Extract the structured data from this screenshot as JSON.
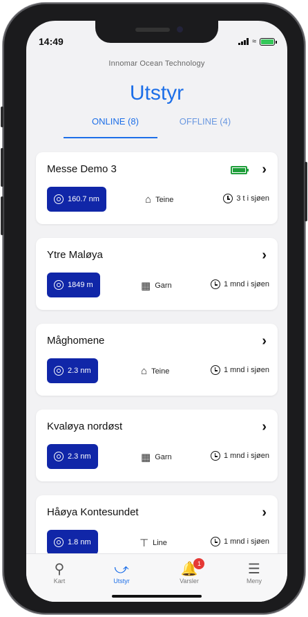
{
  "status": {
    "time": "14:49"
  },
  "header": {
    "org": "Innomar Ocean Technology",
    "title": "Utstyr"
  },
  "tabs": [
    {
      "label": "ONLINE (8)"
    },
    {
      "label": "OFFLINE (4)"
    }
  ],
  "devices": [
    {
      "name": "Messe Demo 3",
      "distance": "160.7 nm",
      "gear": "Teine",
      "gear_icon": "trap-icon",
      "duration": "3 t i sjøen",
      "battery": true
    },
    {
      "name": "Ytre Maløya",
      "distance": "1849 m",
      "gear": "Garn",
      "gear_icon": "net-icon",
      "duration": "1 mnd i sjøen",
      "battery": false
    },
    {
      "name": "Måghomene",
      "distance": "2.3 nm",
      "gear": "Teine",
      "gear_icon": "trap-icon",
      "duration": "1 mnd i sjøen",
      "battery": false
    },
    {
      "name": "Kvaløya nordøst",
      "distance": "2.3 nm",
      "gear": "Garn",
      "gear_icon": "net-icon",
      "duration": "1 mnd i sjøen",
      "battery": false
    },
    {
      "name": "Håøya Kontesundet",
      "distance": "1.8 nm",
      "gear": "Line",
      "gear_icon": "line-icon",
      "duration": "1 mnd i sjøen",
      "battery": false
    }
  ],
  "tabbar": {
    "items": [
      {
        "label": "Kart"
      },
      {
        "label": "Utstyr"
      },
      {
        "label": "Varsler",
        "badge": "1"
      },
      {
        "label": "Meny"
      }
    ]
  },
  "colors": {
    "accent": "#1d6fe8",
    "chip": "#1026a8",
    "battery": "#1e9e3a",
    "badge": "#e53935"
  }
}
